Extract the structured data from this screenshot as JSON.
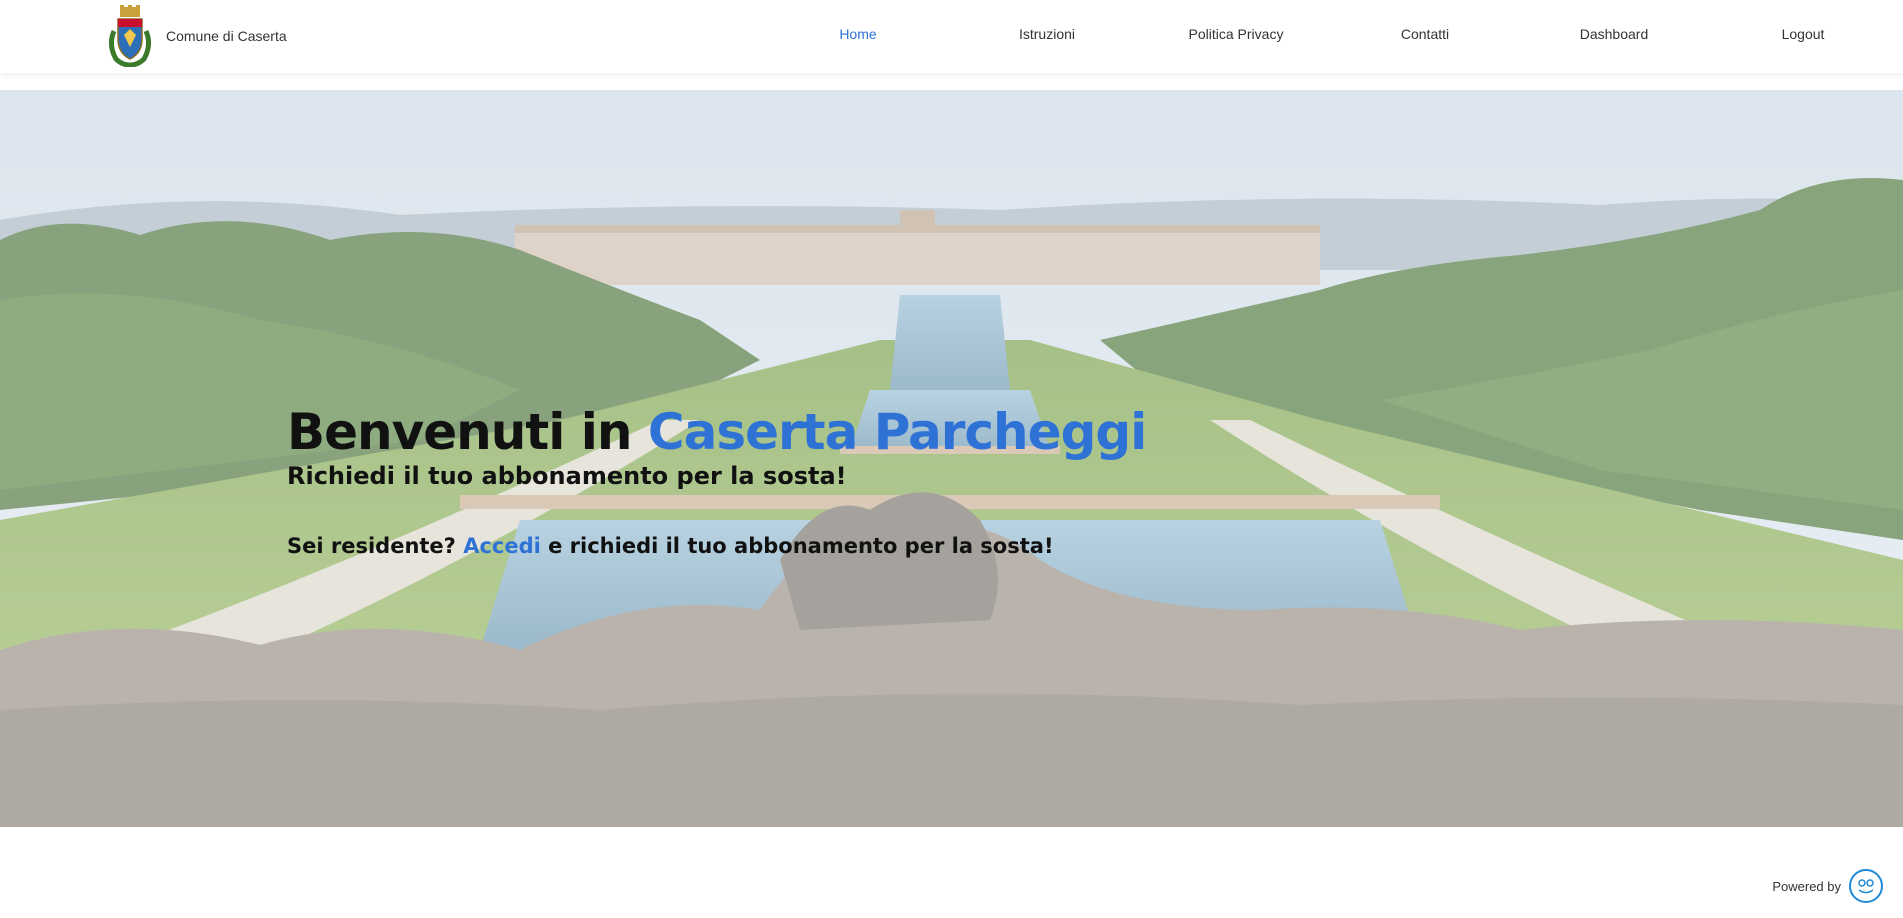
{
  "header": {
    "brand_name": "Comune di Caserta",
    "nav": [
      {
        "label": "Home",
        "active": true
      },
      {
        "label": "Istruzioni",
        "active": false
      },
      {
        "label": "Politica Privacy",
        "active": false
      },
      {
        "label": "Contatti",
        "active": false
      },
      {
        "label": "Dashboard",
        "active": false
      },
      {
        "label": "Logout",
        "active": false
      }
    ]
  },
  "hero": {
    "title_prefix": "Benvenuti in ",
    "title_accent": "Caserta Parcheggi",
    "subtitle": "Richiedi il tuo abbonamento per la sosta!",
    "cta_prefix": "Sei residente? ",
    "cta_link": "Accedi",
    "cta_suffix": " e richiedi il tuo abbonamento per la sosta!"
  },
  "footer": {
    "powered_by": "Powered by"
  },
  "colors": {
    "accent": "#2f72d6",
    "text": "#111111",
    "footer_logo": "#1f8ad6"
  },
  "icons": {
    "brand": "city-crest-icon",
    "footer": "powered-by-logo-icon"
  }
}
